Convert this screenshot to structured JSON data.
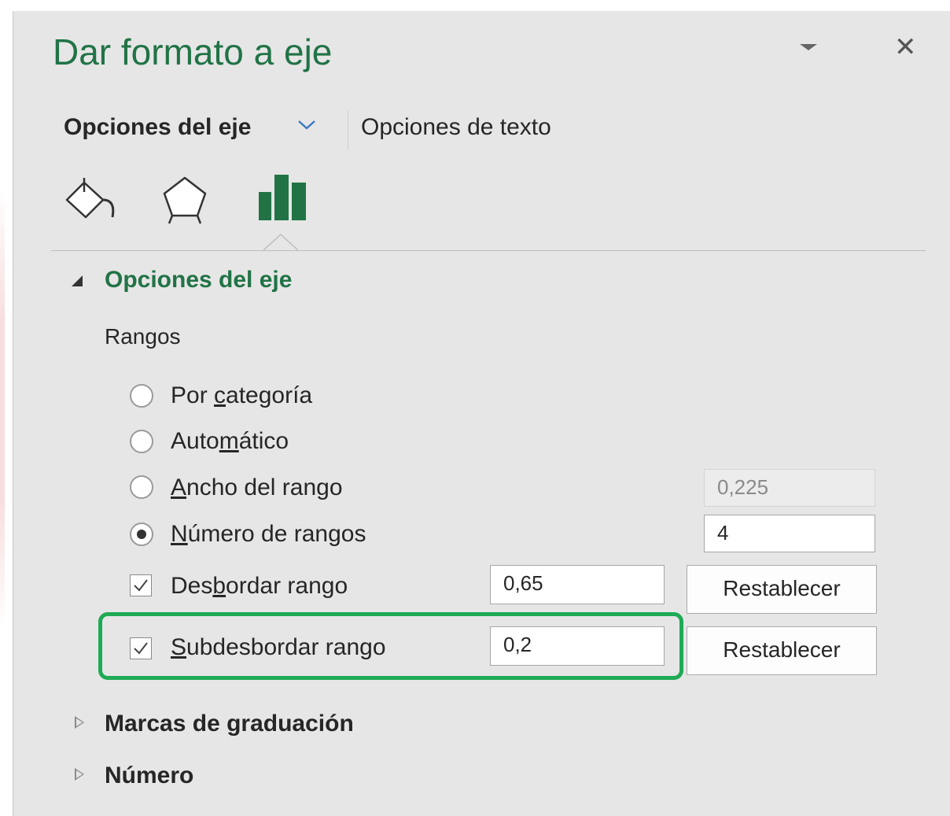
{
  "panel": {
    "title": "Dar formato a eje",
    "icons": {
      "options_menu": "chevron-down-icon",
      "close": "close-icon",
      "close_glyph": "✕"
    },
    "tabs": [
      {
        "label": "Opciones del eje",
        "active": true
      },
      {
        "label": "Opciones de texto",
        "active": false
      }
    ],
    "icon_tabs": [
      "fill-line-icon",
      "effects-icon",
      "axis-options-icon"
    ],
    "active_icon_tab": "axis-options-icon",
    "accent_color": "#217346"
  },
  "axis_options": {
    "section_title": "Opciones del eje",
    "expanded": true,
    "group_label": "Rangos",
    "options": [
      {
        "pre": "Por ",
        "u": "c",
        "post": "ategoría",
        "selected": false
      },
      {
        "pre": "Auto",
        "u": "m",
        "post": "ático",
        "selected": false
      },
      {
        "pre": "",
        "u": "A",
        "post": "ncho del rango",
        "selected": false,
        "value": "0,225",
        "enabled": false
      },
      {
        "pre": "",
        "u": "N",
        "post": "úmero de rangos",
        "selected": true,
        "value": "4",
        "enabled": true
      }
    ],
    "overflow": {
      "pre": "Des",
      "u": "b",
      "post": "ordar rango",
      "checked": true,
      "value": "0,65",
      "reset_label": "Restablecer"
    },
    "underflow": {
      "pre": "",
      "u": "S",
      "post": "ubdesbordar rango",
      "checked": true,
      "value": "0,2",
      "reset_label": "Restablecer",
      "highlight_color": "#1faa55"
    }
  },
  "collapsed_sections": [
    {
      "label": "Marcas de graduación",
      "expanded": false
    },
    {
      "label": "Número",
      "expanded": false
    }
  ]
}
